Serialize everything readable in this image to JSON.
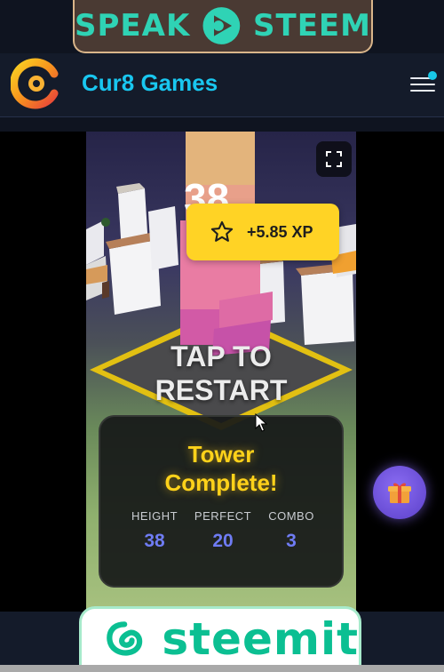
{
  "top_banner": {
    "left_word": "SPEAK",
    "right_word": "STEEM"
  },
  "header": {
    "title": "Cur8 Games"
  },
  "game": {
    "score_behind": "38",
    "xp": "+5.85 XP",
    "restart_line1": "TAP TO",
    "restart_line2": "RESTART",
    "result": {
      "title_line1": "Tower",
      "title_line2": "Complete!",
      "stats": [
        {
          "label": "HEIGHT",
          "value": "38"
        },
        {
          "label": "PERFECT",
          "value": "20"
        },
        {
          "label": "COMBO",
          "value": "3"
        }
      ]
    }
  },
  "bottom_banner": {
    "word": "steemit"
  },
  "icons": {
    "menu": "hamburger-menu-icon",
    "fullscreen": "fullscreen-icon",
    "xp": "star-icon",
    "gift": "gift-icon"
  },
  "colors": {
    "accent": "#19c7f0",
    "xp_badge": "#ffd325",
    "result_title": "#ffd21a",
    "stat_value": "#6f7cf4",
    "gift": "#7a5ae6",
    "steem_green": "#0bbf92"
  }
}
